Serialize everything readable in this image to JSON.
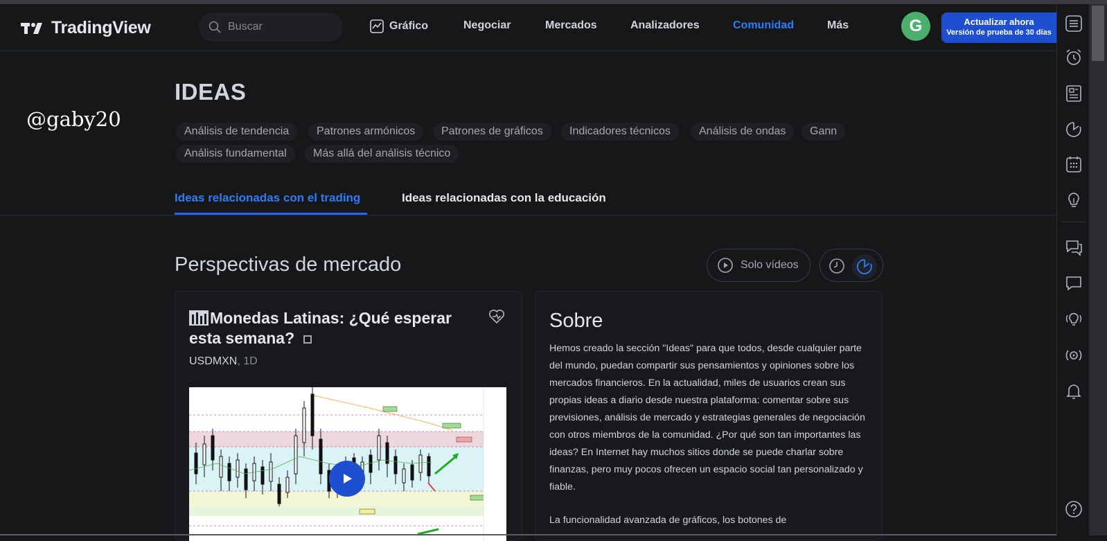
{
  "header": {
    "logo_text": "TradingView",
    "search_placeholder": "Buscar",
    "nav": [
      {
        "label": "Gráfico",
        "icon": "chart-icon"
      },
      {
        "label": "Negociar"
      },
      {
        "label": "Mercados"
      },
      {
        "label": "Analizadores"
      },
      {
        "label": "Comunidad",
        "active": true
      },
      {
        "label": "Más"
      }
    ],
    "avatar_letter": "G",
    "upgrade_title": "Actualizar ahora",
    "upgrade_subtitle": "Versión de prueba de 30 días"
  },
  "watermark": "@gaby20",
  "ideas": {
    "title": "IDEAS",
    "chips": [
      "Análisis de tendencia",
      "Patrones armónicos",
      "Patrones de gráficos",
      "Indicadores técnicos",
      "Análisis de ondas",
      "Gann",
      "Análisis fundamental",
      "Más allá del análisis técnico"
    ],
    "tabs": [
      {
        "label": "Ideas relacionadas con el trading",
        "active": true
      },
      {
        "label": "Ideas relacionadas con la educación"
      }
    ]
  },
  "section": {
    "title": "Perspectivas de mercado",
    "videos_only_label": "Solo vídeos"
  },
  "idea_card": {
    "title": "Monedas Latinas: ¿Qué esperar esta semana?",
    "symbol": "USDMXN",
    "timeframe": ", 1D"
  },
  "about": {
    "title": "Sobre",
    "paragraph1": "Hemos creado la sección \"Ideas\" para que todos, desde cualquier parte del mundo, puedan compartir sus pensamientos y opiniones sobre los mercados financieros. En la actualidad, miles de usuarios crean sus propias ideas a diario desde nuestra plataforma: comentar sobre sus previsiones, análisis de mercado y estrategias generales de negociación con otros miembros de la comunidad. ¿Por qué son tan importantes las ideas? En Internet hay muchos sitios donde se puede charlar sobre finanzas, pero muy pocos ofrecen un espacio social tan personalizado y fiable.",
    "paragraph2": "La funcionalidad avanzada de gráficos, los botones de"
  },
  "colors": {
    "background": "#161719",
    "accent": "#2962ff",
    "active_text": "#2e7cf6",
    "avatar": "#4caf6e"
  }
}
